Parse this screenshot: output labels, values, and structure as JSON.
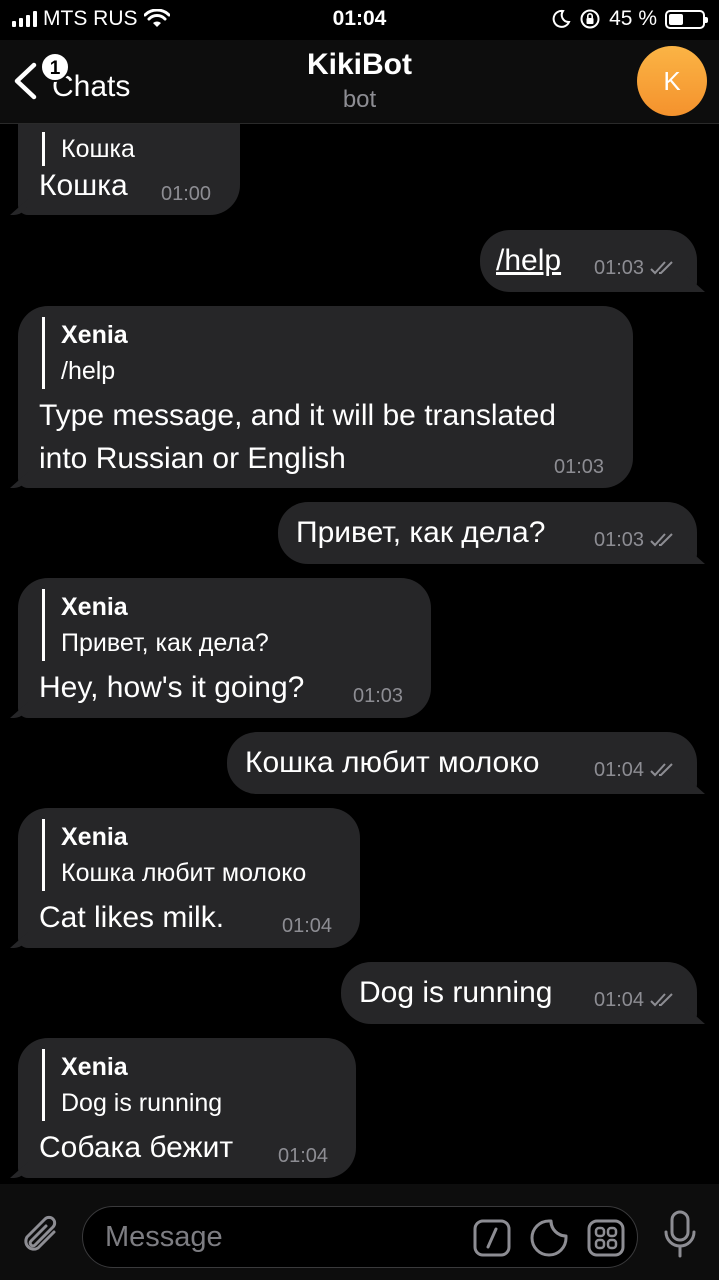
{
  "status_bar": {
    "carrier": "MTS RUS",
    "time": "01:04",
    "battery": "45 %",
    "battery_level": 0.45
  },
  "header": {
    "back_badge": "1",
    "back_label": "Chats",
    "title": "KikiBot",
    "subtitle": "bot",
    "avatar_letter": "K",
    "avatar_color": "#f6a23a"
  },
  "messages": [
    {
      "dir": "in",
      "reply_quote": "Кошка",
      "text": "Кошка",
      "time": "01:00"
    },
    {
      "dir": "out",
      "text": "/help",
      "time": "01:03",
      "status": "read"
    },
    {
      "dir": "in",
      "reply_name": "Xenia",
      "reply_quote": "/help",
      "text_lines": [
        "Type message, and it will be translated",
        "into Russian or English"
      ],
      "time": "01:03"
    },
    {
      "dir": "out",
      "text": "Привет, как дела?",
      "time": "01:03",
      "status": "read"
    },
    {
      "dir": "in",
      "reply_name": "Xenia",
      "reply_quote": "Привет, как дела?",
      "text": "Hey, how's it going?",
      "time": "01:03"
    },
    {
      "dir": "out",
      "text": "Кошка любит молоко",
      "time": "01:04",
      "status": "read"
    },
    {
      "dir": "in",
      "reply_name": "Xenia",
      "reply_quote": "Кошка любит молоко",
      "text": "Cat likes milk.",
      "time": "01:04"
    },
    {
      "dir": "out",
      "text": "Dog is running",
      "time": "01:04",
      "status": "read"
    },
    {
      "dir": "in",
      "reply_name": "Xenia",
      "reply_quote": "Dog is running",
      "text": "Собака бежит",
      "time": "01:04"
    }
  ],
  "input": {
    "placeholder": "Message"
  },
  "colors": {
    "background": "#000000",
    "bubble": "#262628",
    "secondary_text": "#8d8d93"
  }
}
